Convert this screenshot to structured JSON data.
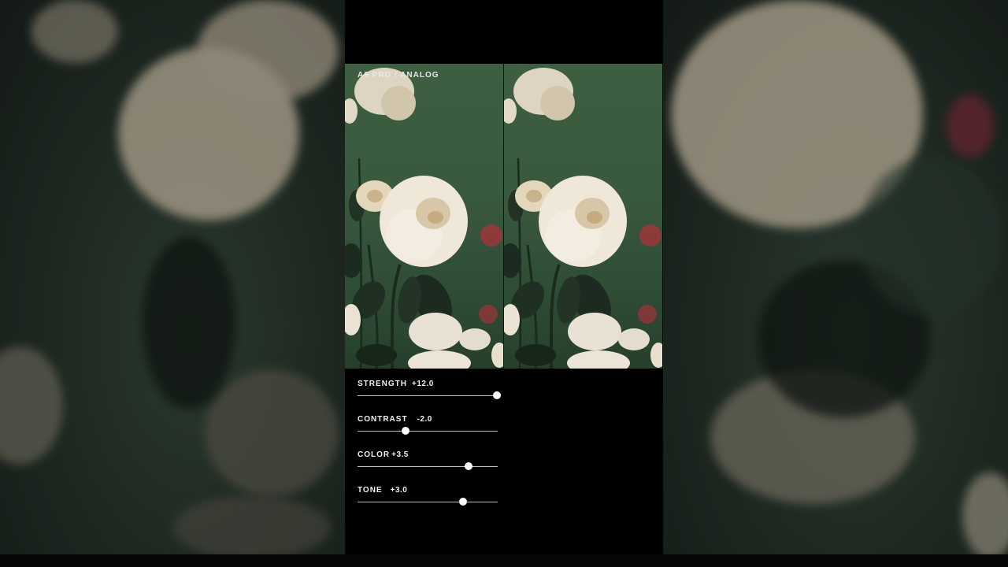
{
  "preset_label": "A6 PRO / ANALOG",
  "sliders": [
    {
      "label": "STRENGTH",
      "value": "+12.0",
      "level": 0.995
    },
    {
      "label": "CONTRAST",
      "value": "-2.0",
      "level": 0.34
    },
    {
      "label": "COLOR",
      "value": "+3.5",
      "level": 0.79
    },
    {
      "label": "TONE",
      "value": "+3.0",
      "level": 0.75
    }
  ],
  "colors": {
    "foliage": "#3d5e41",
    "petal": "#efe7d8",
    "petal_shade": "#d8c6a8",
    "leaf": "#1c2a1f",
    "accent_red": "#b3303a"
  }
}
